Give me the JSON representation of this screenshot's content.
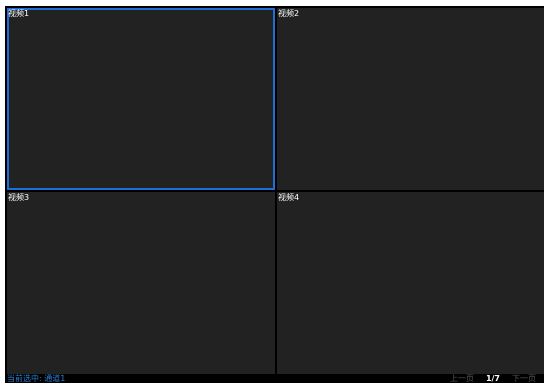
{
  "cells": [
    {
      "label": "视频1",
      "selected": true
    },
    {
      "label": "视频2",
      "selected": false
    },
    {
      "label": "视频3",
      "selected": false
    },
    {
      "label": "视频4",
      "selected": false
    }
  ],
  "status": {
    "current_selection": "当前选中: 通道1"
  },
  "pager": {
    "prev_label": "上一页",
    "page_indicator": "1/7",
    "next_label": "下一页"
  },
  "colors": {
    "selected_border": "#1e6fd6",
    "status_text": "#2a7fd4",
    "cell_background": "#222222"
  }
}
